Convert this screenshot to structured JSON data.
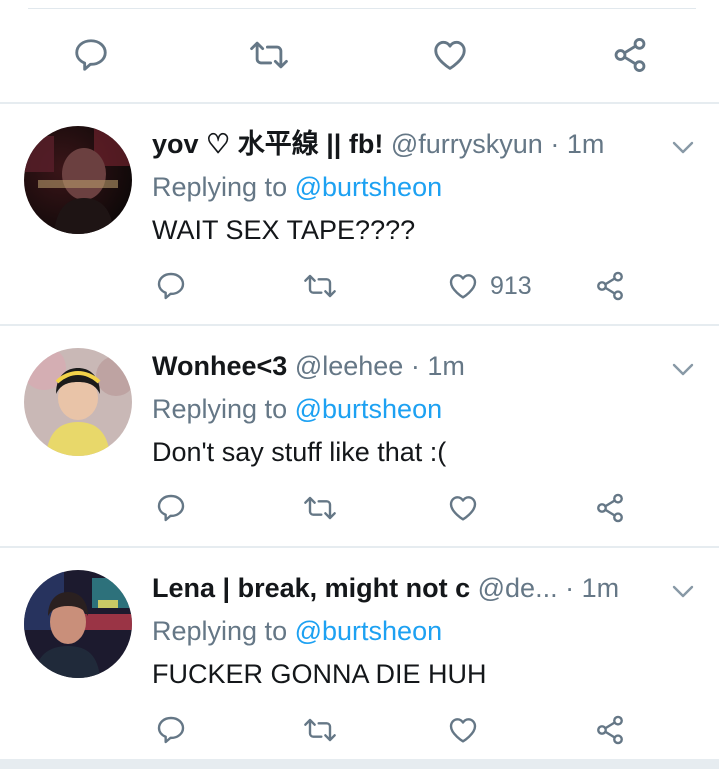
{
  "top_actions": {
    "icons": [
      "reply-icon",
      "retweet-icon",
      "like-icon",
      "share-icon"
    ]
  },
  "tweets": [
    {
      "name": "yov ♡ 水平線 || fb!",
      "handle": "@furryskyun",
      "separator": "·",
      "time": "1m",
      "replying_prefix": "Replying to",
      "replying_to": "@burtsheon",
      "text": "WAIT SEX TAPE????",
      "like_count": "913"
    },
    {
      "name": "Wonhee<3",
      "handle": "@leehee",
      "separator": "·",
      "time": "1m",
      "replying_prefix": "Replying to",
      "replying_to": "@burtsheon",
      "text": "Don't say stuff like that :(",
      "like_count": ""
    },
    {
      "name": "Lena | break, might not c",
      "handle": "@de...",
      "separator": "·",
      "time": "1m",
      "replying_prefix": "Replying to",
      "replying_to": "@burtsheon",
      "text": "FUCKER GONNA DIE HUH",
      "like_count": ""
    }
  ],
  "colors": {
    "icon_gray": "#657786",
    "link_blue": "#1da1f2",
    "divider": "#e6ecf0"
  }
}
